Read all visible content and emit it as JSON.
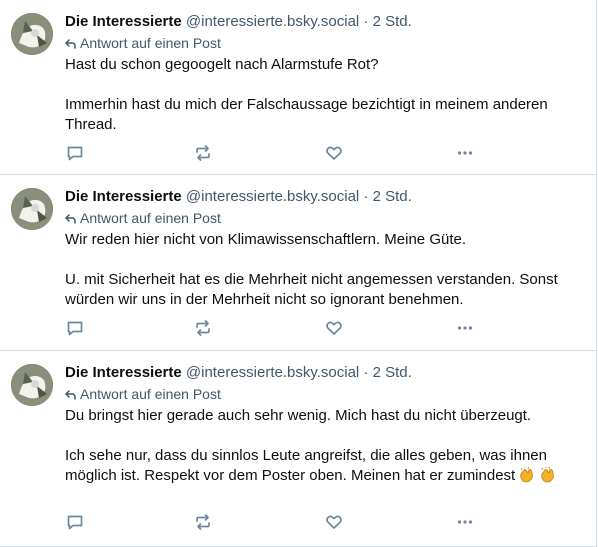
{
  "posts": [
    {
      "author_name": "Die Interessierte",
      "handle": "@interessierte.bsky.social",
      "separator": "·",
      "time": "2 Std.",
      "reply_label": "Antwort auf einen Post",
      "lines": [
        "Hast du schon gegoogelt nach Alarmstufe Rot?",
        "",
        "Immerhin hast du mich der Falschaussage bezichtigt in meinem anderen Thread."
      ]
    },
    {
      "author_name": "Die Interessierte",
      "handle": "@interessierte.bsky.social",
      "separator": "·",
      "time": "2 Std.",
      "reply_label": "Antwort auf einen Post",
      "lines": [
        "Wir reden hier nicht von Klimawissenschaftlern. Meine Güte.",
        "",
        "U. mit Sicherheit hat es die Mehrheit nicht angemessen verstanden. Sonst würden wir uns in der Mehrheit nicht so ignorant benehmen."
      ]
    },
    {
      "author_name": "Die Interessierte",
      "handle": "@interessierte.bsky.social",
      "separator": "·",
      "time": "2 Std.",
      "reply_label": "Antwort auf einen Post",
      "lines": [
        "Du bringst hier gerade auch sehr wenig. Mich hast du nicht überzeugt.",
        "",
        "Ich sehe nur, dass du sinnlos Leute angreifst, die alles geben, was ihnen möglich ist. Respekt vor dem Poster oben. Meinen hat er zumindest"
      ],
      "emoji": "clapping-hands"
    }
  ],
  "icons": {
    "reply": "speech-bubble-icon",
    "repost": "repost-arrows-icon",
    "like": "heart-icon",
    "more": "ellipsis-icon",
    "reply_indicator": "reply-arrow-icon"
  },
  "colors": {
    "text": "#0b0f14",
    "muted": "#42576c",
    "icon": "#6f869f",
    "divider": "#d4dbe2",
    "emoji": "#f5b324"
  }
}
